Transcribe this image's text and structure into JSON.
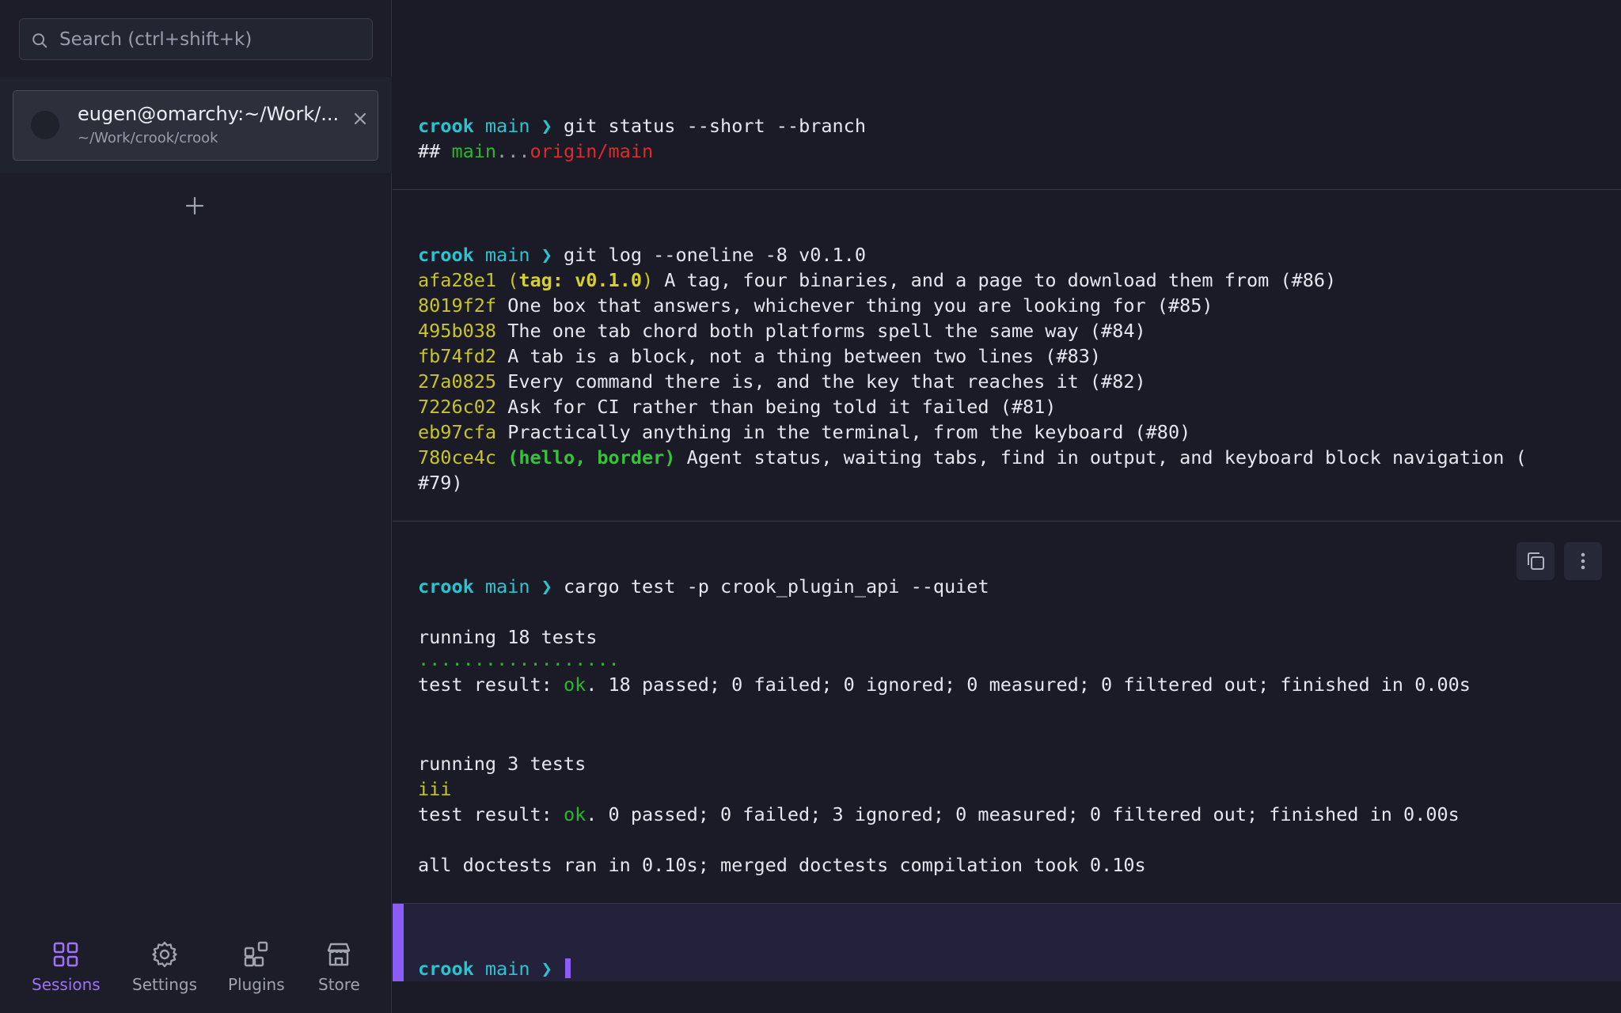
{
  "search": {
    "placeholder": "Search (ctrl+shift+k)"
  },
  "session": {
    "title": "eugen@omarchy:~/Work/...",
    "path": "~/Work/crook/crook"
  },
  "nav": [
    {
      "label": "Sessions",
      "icon": "grid-icon",
      "active": true
    },
    {
      "label": "Settings",
      "icon": "gear-icon",
      "active": false
    },
    {
      "label": "Plugins",
      "icon": "plugins-icon",
      "active": false
    },
    {
      "label": "Store",
      "icon": "store-icon",
      "active": false
    }
  ],
  "colors": {
    "accent": "#8b5cf6",
    "prompt_dir": "#2ac3d0",
    "ok": "#2db52d",
    "hash": "#c8c42a",
    "remote": "#e02a2a"
  },
  "prompt": {
    "dir": "crook",
    "branch": "main",
    "symbol": "❯"
  },
  "blocks": [
    {
      "command": "git status --short --branch",
      "output": {
        "prefix": "## ",
        "local": "main",
        "sep": "...",
        "remote": "origin/main"
      }
    },
    {
      "command": "git log --oneline -8 v0.1.0",
      "commits": [
        {
          "hash": "afa28e1",
          "ref_open": "(",
          "ref": "tag: v0.1.0",
          "ref_close": ")",
          "msg": " A tag, four binaries, and a page to download them from (#86)"
        },
        {
          "hash": "8019f2f",
          "msg": " One box that answers, whichever thing you are looking for (#85)"
        },
        {
          "hash": "495b038",
          "msg": " The one tab chord both platforms spell the same way (#84)"
        },
        {
          "hash": "fb74fd2",
          "msg": " A tab is a block, not a thing between two lines (#83)"
        },
        {
          "hash": "27a0825",
          "msg": " Every command there is, and the key that reaches it (#82)"
        },
        {
          "hash": "7226c02",
          "msg": " Ask for CI rather than being told it failed (#81)"
        },
        {
          "hash": "eb97cfa",
          "msg": " Practically anything in the terminal, from the keyboard (#80)"
        },
        {
          "hash": "780ce4c",
          "ref_open": "(",
          "ref": "hello, border",
          "ref_close": ")",
          "msg": " Agent status, waiting tabs, find in output, and keyboard block navigation (",
          "wrap": "#79)"
        }
      ]
    },
    {
      "command": "cargo test -p crook_plugin_api --quiet",
      "lines": {
        "run1": "running 18 tests",
        "dots": "..................",
        "res1_pre": "test result: ",
        "res1_ok": "ok",
        "res1_post": ". 18 passed; 0 failed; 0 ignored; 0 measured; 0 filtered out; finished in 0.00s",
        "run2": "running 3 tests",
        "ignored": "iii",
        "res2_pre": "test result: ",
        "res2_ok": "ok",
        "res2_post": ". 0 passed; 0 failed; 3 ignored; 0 measured; 0 filtered out; finished in 0.00s",
        "doctests": "all doctests ran in 0.10s; merged doctests compilation took 0.10s"
      }
    }
  ]
}
